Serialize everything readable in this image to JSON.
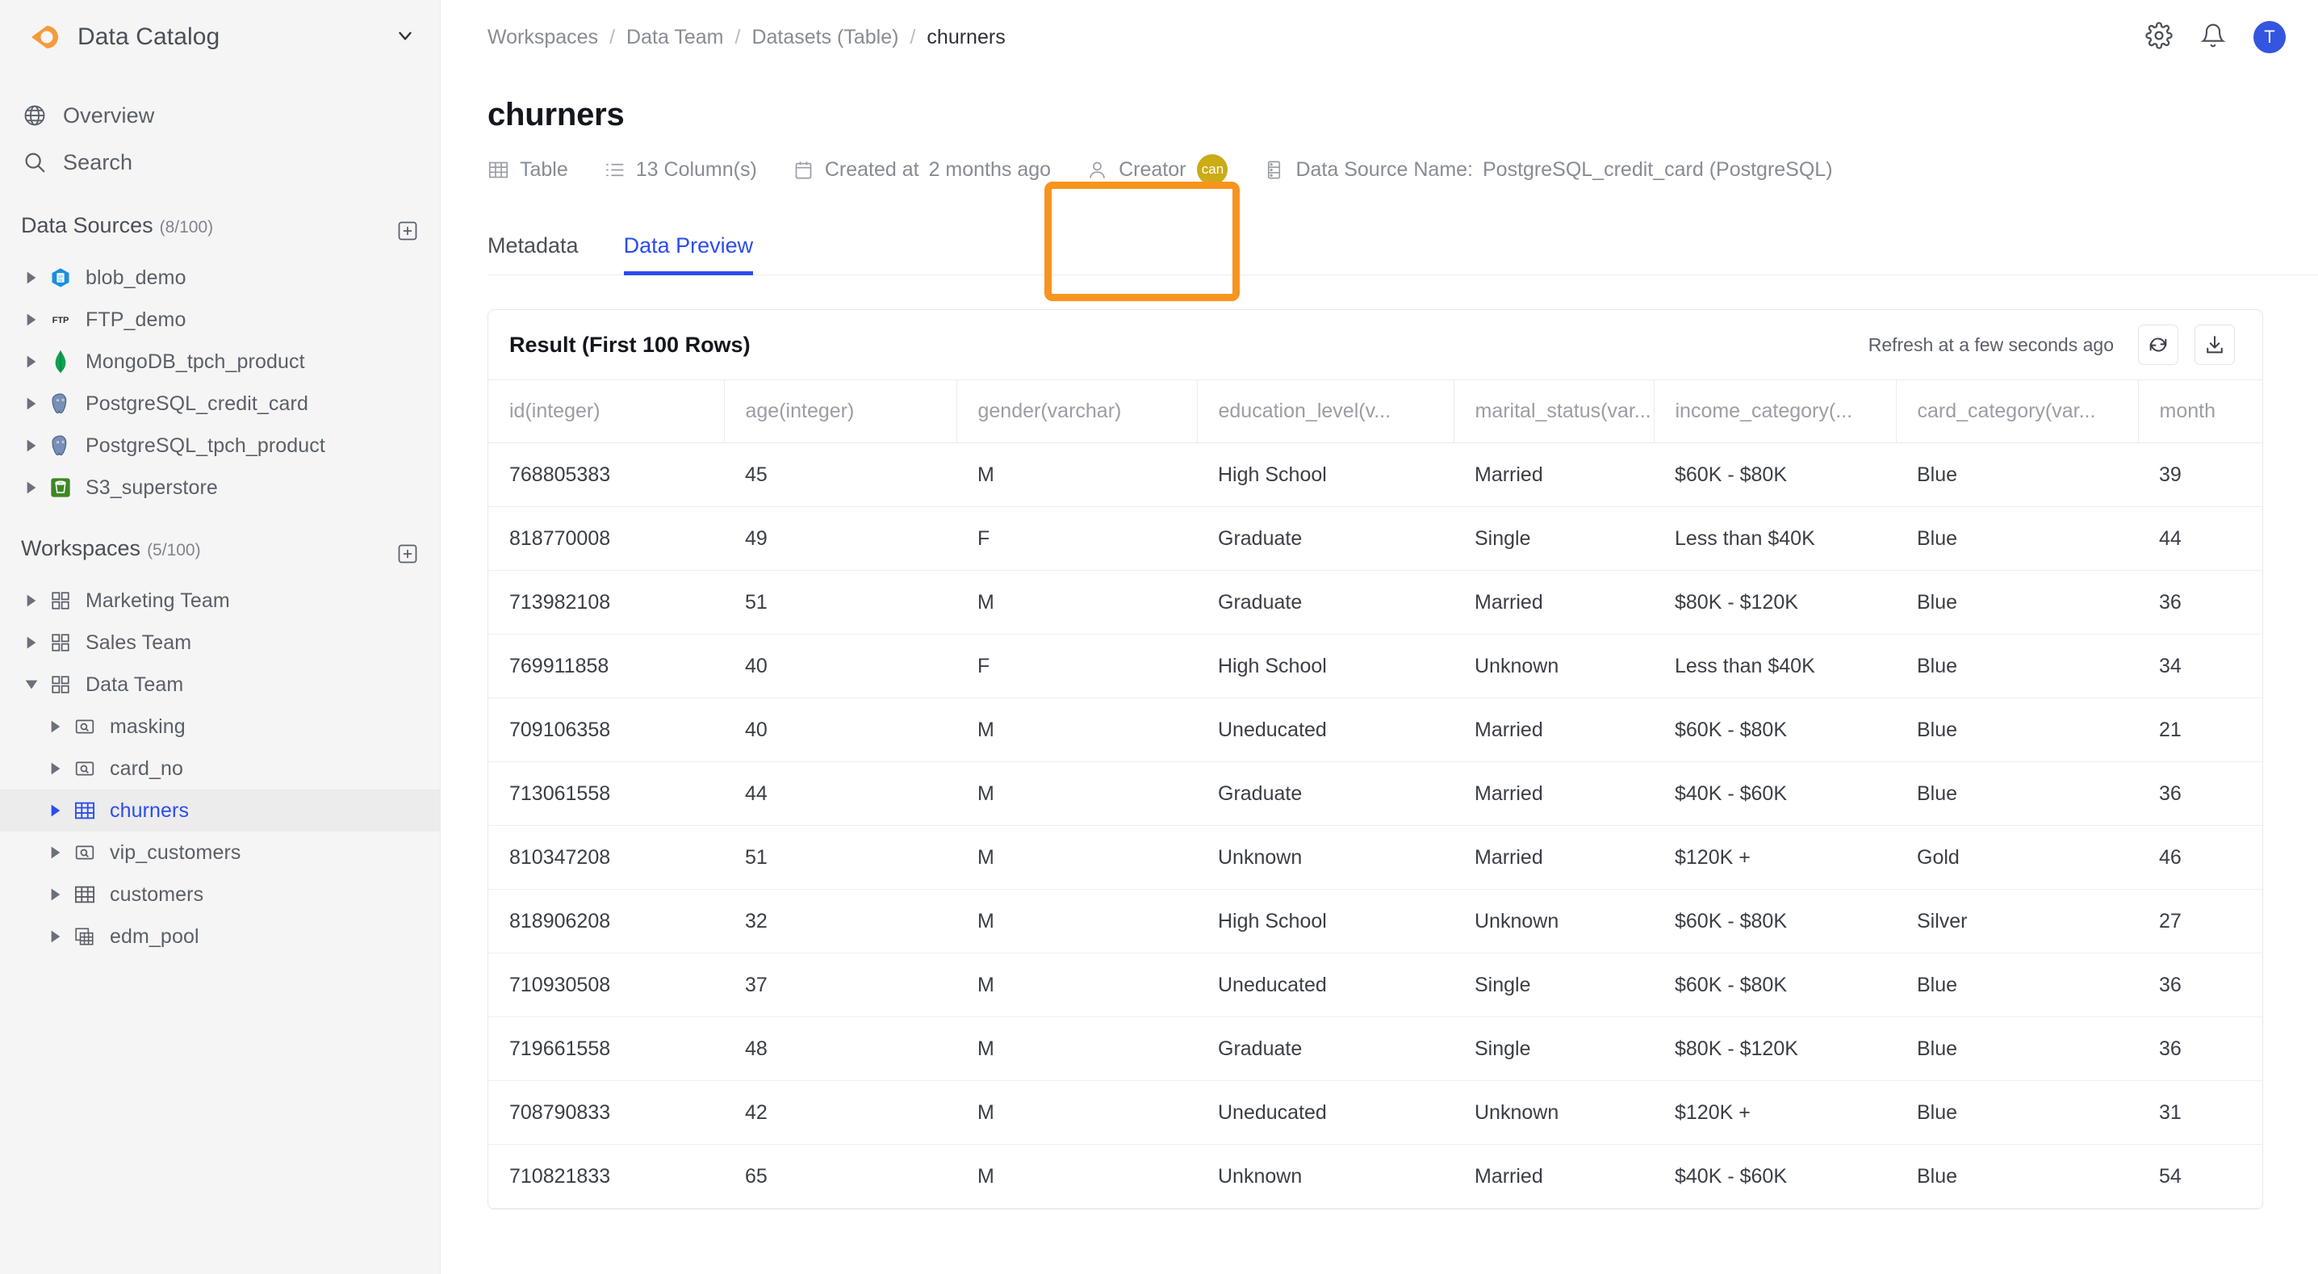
{
  "sidebar": {
    "brand": {
      "name": "Data Catalog",
      "logo_icon": "location-pin-logo",
      "chevron_icon": "chevron-down-icon"
    },
    "nav": [
      {
        "label": "Overview",
        "icon": "globe-icon"
      },
      {
        "label": "Search",
        "icon": "search-icon"
      }
    ],
    "data_sources": {
      "title": "Data Sources",
      "count": "(8/100)",
      "add_icon": "plus-square-icon",
      "items": [
        {
          "label": "blob_demo",
          "icon": "azure-blob-icon",
          "expanded": false
        },
        {
          "label": "FTP_demo",
          "icon": "ftp-icon",
          "expanded": false
        },
        {
          "label": "MongoDB_tpch_product",
          "icon": "mongodb-icon",
          "expanded": false
        },
        {
          "label": "PostgreSQL_credit_card",
          "icon": "postgresql-icon",
          "expanded": false
        },
        {
          "label": "PostgreSQL_tpch_product",
          "icon": "postgresql-icon",
          "expanded": false
        },
        {
          "label": "S3_superstore",
          "icon": "s3-bucket-icon",
          "expanded": false
        }
      ]
    },
    "workspaces": {
      "title": "Workspaces",
      "count": "(5/100)",
      "add_icon": "plus-square-icon",
      "items": [
        {
          "label": "Marketing Team",
          "icon": "workspace-grid-icon",
          "expanded": false,
          "indent": false,
          "selected": false
        },
        {
          "label": "Sales Team",
          "icon": "workspace-grid-icon",
          "expanded": false,
          "indent": false,
          "selected": false
        },
        {
          "label": "Data Team",
          "icon": "workspace-grid-icon",
          "expanded": true,
          "indent": false,
          "selected": false
        },
        {
          "label": "masking",
          "icon": "query-icon",
          "expanded": false,
          "indent": true,
          "selected": false
        },
        {
          "label": "card_no",
          "icon": "query-icon",
          "expanded": false,
          "indent": true,
          "selected": false
        },
        {
          "label": "churners",
          "icon": "table-icon",
          "expanded": false,
          "indent": true,
          "selected": true
        },
        {
          "label": "vip_customers",
          "icon": "query-icon",
          "expanded": false,
          "indent": true,
          "selected": false
        },
        {
          "label": "customers",
          "icon": "table-icon",
          "expanded": false,
          "indent": true,
          "selected": false
        },
        {
          "label": "edm_pool",
          "icon": "pool-icon",
          "expanded": false,
          "indent": true,
          "selected": false
        }
      ]
    }
  },
  "topbar": {
    "breadcrumb": [
      "Workspaces",
      "Data Team",
      "Datasets (Table)",
      "churners"
    ],
    "separator": "/",
    "settings_icon": "gear-icon",
    "notifications_icon": "bell-icon",
    "avatar_initial": "T"
  },
  "page": {
    "title": "churners",
    "meta": {
      "type_label": "Table",
      "type_icon": "table-icon",
      "columns_label": "13 Column(s)",
      "columns_icon": "list-icon",
      "created_label": "Created at",
      "created_value": "2 months ago",
      "created_icon": "calendar-icon",
      "creator_label": "Creator",
      "creator_icon": "person-icon",
      "creator_initials": "can",
      "datasource_label": "Data Source Name:",
      "datasource_value": "PostgreSQL_credit_card (PostgreSQL)",
      "datasource_icon": "database-icon"
    },
    "tabs": [
      {
        "label": "Metadata",
        "active": false
      },
      {
        "label": "Data Preview",
        "active": true
      }
    ],
    "highlight_color": "#F7941D",
    "accent_color": "#2b4cf0"
  },
  "result": {
    "title": "Result (First 100 Rows)",
    "refresh_text": "Refresh at a few seconds ago",
    "refresh_icon": "refresh-icon",
    "download_icon": "download-icon",
    "columns": [
      "id(integer)",
      "age(integer)",
      "gender(varchar)",
      "education_level(v...",
      "marital_status(var...",
      "income_category(...",
      "card_category(var...",
      "month"
    ],
    "rows": [
      [
        "768805383",
        "45",
        "M",
        "High School",
        "Married",
        "$60K - $80K",
        "Blue",
        "39"
      ],
      [
        "818770008",
        "49",
        "F",
        "Graduate",
        "Single",
        "Less than $40K",
        "Blue",
        "44"
      ],
      [
        "713982108",
        "51",
        "M",
        "Graduate",
        "Married",
        "$80K - $120K",
        "Blue",
        "36"
      ],
      [
        "769911858",
        "40",
        "F",
        "High School",
        "Unknown",
        "Less than $40K",
        "Blue",
        "34"
      ],
      [
        "709106358",
        "40",
        "M",
        "Uneducated",
        "Married",
        "$60K - $80K",
        "Blue",
        "21"
      ],
      [
        "713061558",
        "44",
        "M",
        "Graduate",
        "Married",
        "$40K - $60K",
        "Blue",
        "36"
      ],
      [
        "810347208",
        "51",
        "M",
        "Unknown",
        "Married",
        "$120K +",
        "Gold",
        "46"
      ],
      [
        "818906208",
        "32",
        "M",
        "High School",
        "Unknown",
        "$60K - $80K",
        "Silver",
        "27"
      ],
      [
        "710930508",
        "37",
        "M",
        "Uneducated",
        "Single",
        "$60K - $80K",
        "Blue",
        "36"
      ],
      [
        "719661558",
        "48",
        "M",
        "Graduate",
        "Single",
        "$80K - $120K",
        "Blue",
        "36"
      ],
      [
        "708790833",
        "42",
        "M",
        "Uneducated",
        "Unknown",
        "$120K +",
        "Blue",
        "31"
      ],
      [
        "710821833",
        "65",
        "M",
        "Unknown",
        "Married",
        "$40K - $60K",
        "Blue",
        "54"
      ]
    ]
  }
}
